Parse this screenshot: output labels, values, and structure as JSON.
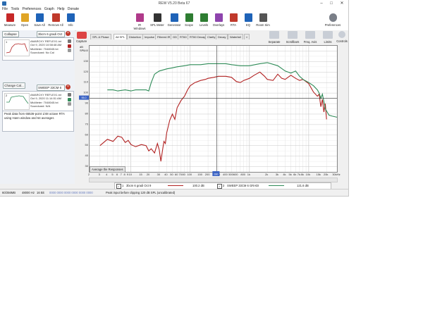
{
  "window": {
    "title": "REW V5.20 Beta 67",
    "controls": [
      "–",
      "□",
      "✕"
    ]
  },
  "menu": [
    "File",
    "Tools",
    "Preferences",
    "Graph",
    "Help",
    "Donate"
  ],
  "toolbar_left": [
    {
      "label": "Measure",
      "icon": "microphone-icon",
      "color": "#c62828"
    },
    {
      "label": "Open",
      "icon": "folder-icon",
      "color": "#e0a526"
    },
    {
      "label": "Save All",
      "icon": "save-icon",
      "color": "#1e63b8"
    },
    {
      "label": "Remove All",
      "icon": "remove-icon",
      "color": "#c0392b"
    },
    {
      "label": "Info",
      "icon": "info-icon",
      "color": "#1e63b8"
    }
  ],
  "toolbar_right": [
    {
      "label": "IR Windows",
      "icon": "ir-windows-icon",
      "color": "#b03a8a"
    },
    {
      "label": "SPL Meter",
      "icon": "spl-meter-icon",
      "color": "#333333"
    },
    {
      "label": "Generator",
      "icon": "generator-icon",
      "color": "#1e63b8"
    },
    {
      "label": "Scope",
      "icon": "scope-icon",
      "color": "#2e7d32"
    },
    {
      "label": "Levels",
      "icon": "levels-icon",
      "color": "#2e7d32"
    },
    {
      "label": "Overlays",
      "icon": "overlays-icon",
      "color": "#8e44ad"
    },
    {
      "label": "RTA",
      "icon": "rta-icon",
      "color": "#c0392b"
    },
    {
      "label": "EQ",
      "icon": "eq-icon",
      "color": "#1e63b8"
    },
    {
      "label": "Room Sim",
      "icon": "room-sim-icon",
      "color": "#555555"
    }
  ],
  "preferences_label": "Preferences",
  "left_panel": {
    "collapse_label": "Collapse",
    "name_field_value": "3bcm 6 gradi Oct 9",
    "change_cal_label": "Change Cal...",
    "measurements": [
      {
        "number": "1",
        "name": "3bcm 6 gradi Oct 9",
        "lines": [
          "AMARCKY REFLEX1.txt",
          "Oct 9, 2020 10:58:48 AM",
          "MicMeter: 7048045.txt",
          "Soundcard: No Cal"
        ],
        "color": "#b22222"
      },
      {
        "number": "2",
        "name": "SWEEP 33CM 6 GRADI",
        "lines": [
          "AMARCKY REFLEX1.txt",
          "Oct 9, 2020 11:14:51 AM",
          "MicMeter: 7048045.txt",
          "Soundcard: N/A"
        ],
        "color": "#2e8b57"
      }
    ],
    "notes": "Peak data from 65536-point 1/48 octave RTA using Hann window and 64 averages"
  },
  "capture_label": "Capture",
  "tabs": [
    "SPL & Phase",
    "All SPL",
    "Distortion",
    "Impulse",
    "Filtered IR",
    "GD",
    "RT60",
    "RT60 Decay",
    "Clarity",
    "Decay",
    "Waterfall"
  ],
  "active_tab": "All SPL",
  "right_buttons": [
    {
      "label": "Separate",
      "icon": "separate-icon"
    },
    {
      "label": "Scrollbars",
      "icon": "scrollbars-icon"
    },
    {
      "label": "Freq. Axis",
      "icon": "freq-axis-icon"
    },
    {
      "label": "Limits",
      "icon": "limits-icon"
    },
    {
      "label": "Controls",
      "icon": "controls-icon"
    }
  ],
  "average_button_label": "Average the Responses",
  "legend": [
    {
      "index": "1",
      "name": "3bcm 6 gradi Oct 9",
      "value": "100.2 dB",
      "color": "#b22222"
    },
    {
      "index": "2",
      "name": "SWEEP 33CM 6 GRADI",
      "value": "121.6 dB",
      "color": "#2e8b57"
    }
  ],
  "status": {
    "memory": "60/256MB",
    "sample_rate": "48000 Hz",
    "bits": "16 Bit",
    "levels": "0000 0000 0000 0000 0000 0000",
    "message": "Peak input before clipping 120 dB SPL (uncalibrated)"
  },
  "chart_data": {
    "type": "line",
    "xscale": "log",
    "xlim": [
      2,
      30000
    ],
    "ylim": [
      25,
      145
    ],
    "ylabel": "dB SPL",
    "grid": true,
    "cursor_freq": "280",
    "cursor_level": "95.0",
    "x_ticks": [
      "2",
      "3",
      "4",
      "5",
      "6",
      "7",
      "8",
      "9",
      "10",
      "15",
      "20",
      "30",
      "40",
      "50",
      "60",
      "70",
      "80",
      "100",
      "150",
      "200",
      "300",
      "400",
      "500",
      "600",
      "800",
      "1k",
      "2k",
      "3k",
      "4k",
      "5k",
      "6k",
      "7k",
      "8k",
      "10k",
      "15k",
      "20k",
      "30kHz"
    ],
    "x_tick_values": [
      2,
      3,
      4,
      5,
      6,
      7,
      8,
      9,
      10,
      15,
      20,
      30,
      40,
      50,
      60,
      70,
      80,
      100,
      150,
      200,
      300,
      400,
      500,
      600,
      800,
      1000,
      2000,
      3000,
      4000,
      5000,
      6000,
      7000,
      8000,
      10000,
      15000,
      20000,
      30000
    ],
    "y_ticks": [
      140,
      130,
      120,
      110,
      100,
      90,
      80,
      70,
      60,
      50,
      40,
      30
    ],
    "series": [
      {
        "name": "3bcm 6 gradi Oct 9",
        "color": "#b22222",
        "points": [
          [
            3,
            50
          ],
          [
            4,
            56
          ],
          [
            5,
            54
          ],
          [
            6,
            59
          ],
          [
            7,
            58
          ],
          [
            8,
            53
          ],
          [
            9,
            55
          ],
          [
            10,
            51
          ],
          [
            12,
            49
          ],
          [
            15,
            51
          ],
          [
            18,
            50
          ],
          [
            20,
            45
          ],
          [
            22,
            47
          ],
          [
            25,
            43
          ],
          [
            28,
            52
          ],
          [
            30,
            46
          ],
          [
            32,
            35
          ],
          [
            34,
            45
          ],
          [
            36,
            54
          ],
          [
            38,
            52
          ],
          [
            40,
            62
          ],
          [
            45,
            74
          ],
          [
            50,
            80
          ],
          [
            55,
            75
          ],
          [
            60,
            86
          ],
          [
            70,
            93
          ],
          [
            80,
            97
          ],
          [
            90,
            103
          ],
          [
            100,
            107
          ],
          [
            120,
            110
          ],
          [
            150,
            112
          ],
          [
            180,
            113
          ],
          [
            200,
            114
          ],
          [
            250,
            115
          ],
          [
            300,
            116
          ],
          [
            400,
            116
          ],
          [
            500,
            115
          ],
          [
            600,
            111
          ],
          [
            700,
            110
          ],
          [
            800,
            112
          ],
          [
            1000,
            114
          ],
          [
            1200,
            117
          ],
          [
            1500,
            120
          ],
          [
            1800,
            116
          ],
          [
            2000,
            113
          ],
          [
            2500,
            112
          ],
          [
            3000,
            118
          ],
          [
            3500,
            114
          ],
          [
            4000,
            113
          ],
          [
            5000,
            117
          ],
          [
            6000,
            114
          ],
          [
            7000,
            112
          ],
          [
            8000,
            113
          ],
          [
            10000,
            109
          ],
          [
            12000,
            101
          ],
          [
            14000,
            97
          ],
          [
            15000,
            99
          ],
          [
            16000,
            87
          ],
          [
            17000,
            94
          ],
          [
            18000,
            82
          ],
          [
            19000,
            90
          ],
          [
            20000,
            75
          ]
        ]
      },
      {
        "name": "SWEEP 33CM 6 GRADI",
        "color": "#2e8b57",
        "points": [
          [
            4,
            103
          ],
          [
            5,
            103
          ],
          [
            6,
            102
          ],
          [
            8,
            103
          ],
          [
            10,
            102
          ],
          [
            12,
            103
          ],
          [
            15,
            103
          ],
          [
            18,
            103
          ],
          [
            20,
            102
          ],
          [
            22,
            110
          ],
          [
            25,
            118
          ],
          [
            30,
            121
          ],
          [
            40,
            123
          ],
          [
            50,
            124
          ],
          [
            60,
            125
          ],
          [
            80,
            126
          ],
          [
            100,
            127
          ],
          [
            150,
            127
          ],
          [
            200,
            128
          ],
          [
            300,
            128
          ],
          [
            400,
            128
          ],
          [
            500,
            127
          ],
          [
            700,
            126
          ],
          [
            1000,
            126
          ],
          [
            1500,
            128
          ],
          [
            2000,
            129
          ],
          [
            3000,
            126
          ],
          [
            4000,
            121
          ],
          [
            5000,
            119
          ],
          [
            6000,
            121
          ],
          [
            7000,
            116
          ],
          [
            8000,
            113
          ],
          [
            10000,
            110
          ],
          [
            12000,
            107
          ],
          [
            14000,
            103
          ],
          [
            15000,
            100
          ],
          [
            16000,
            95
          ],
          [
            17000,
            99
          ],
          [
            18000,
            92
          ],
          [
            19000,
            85
          ],
          [
            20000,
            83
          ],
          [
            22000,
            79
          ],
          [
            25000,
            78
          ],
          [
            30000,
            77
          ]
        ]
      }
    ]
  }
}
